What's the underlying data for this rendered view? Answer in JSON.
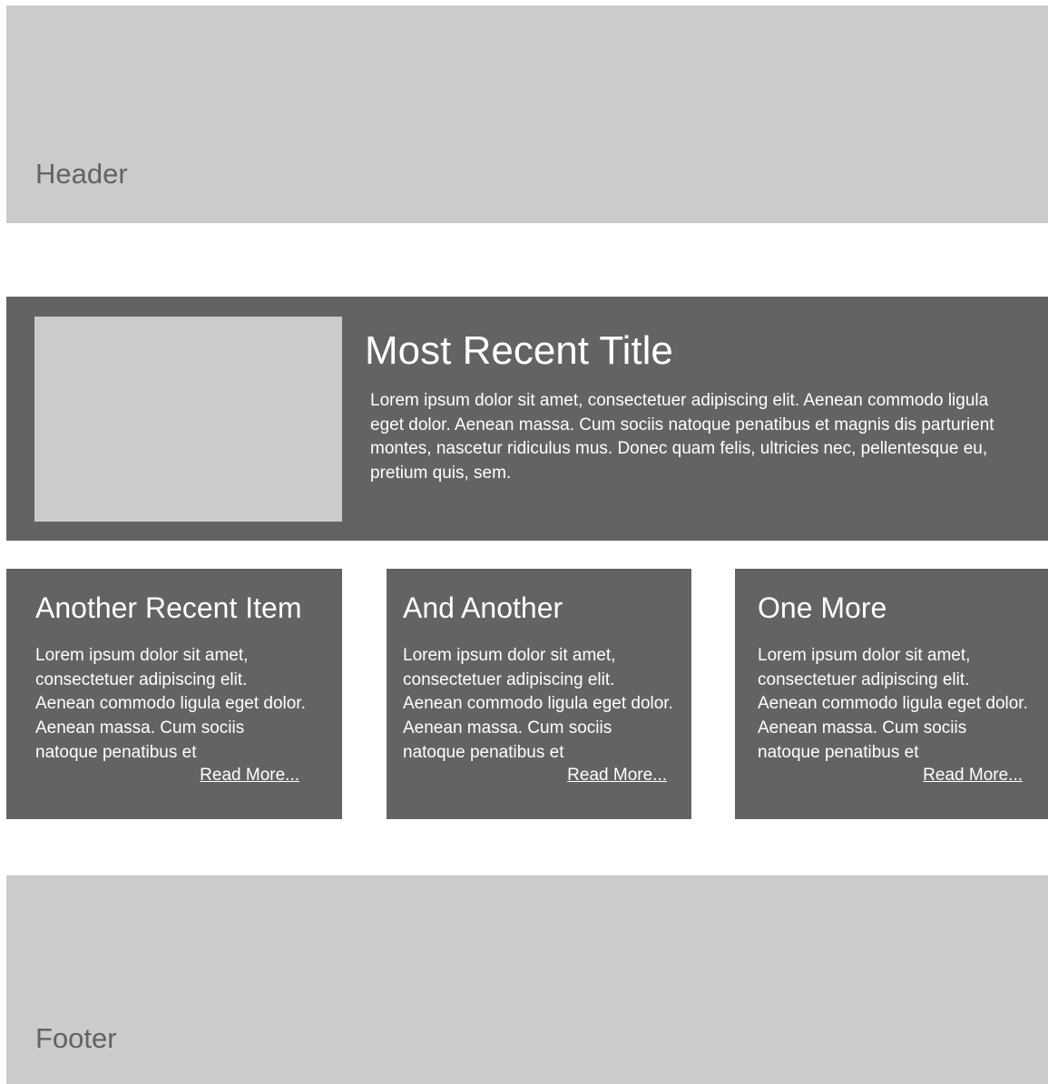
{
  "header": {
    "label": "Header"
  },
  "featured": {
    "title": "Most Recent Title",
    "body": "Lorem ipsum dolor sit amet, consectetuer adipiscing elit. Aenean commodo ligula eget dolor. Aenean massa. Cum sociis natoque penatibus et magnis dis parturient montes, nascetur ridiculus mus. Donec quam felis, ultricies nec, pellentesque eu, pretium quis, sem."
  },
  "cards": [
    {
      "title": "Another Recent Item",
      "body": "Lorem ipsum dolor sit amet, consectetuer adipiscing elit. Aenean commodo ligula eget dolor. Aenean massa. Cum sociis natoque penatibus et",
      "link": "Read More..."
    },
    {
      "title": "And Another",
      "body": "Lorem ipsum dolor sit amet, consectetuer adipiscing elit. Aenean commodo ligula eget dolor. Aenean massa. Cum sociis natoque penatibus et",
      "link": "Read More..."
    },
    {
      "title": "One More",
      "body": "Lorem ipsum dolor sit amet, consectetuer adipiscing elit. Aenean commodo ligula eget dolor. Aenean massa. Cum sociis natoque penatibus et",
      "link": "Read More..."
    }
  ],
  "footer": {
    "label": "Footer"
  },
  "colors": {
    "light_gray": "#cbcbcb",
    "dark_gray": "#636363",
    "white": "#ffffff"
  }
}
